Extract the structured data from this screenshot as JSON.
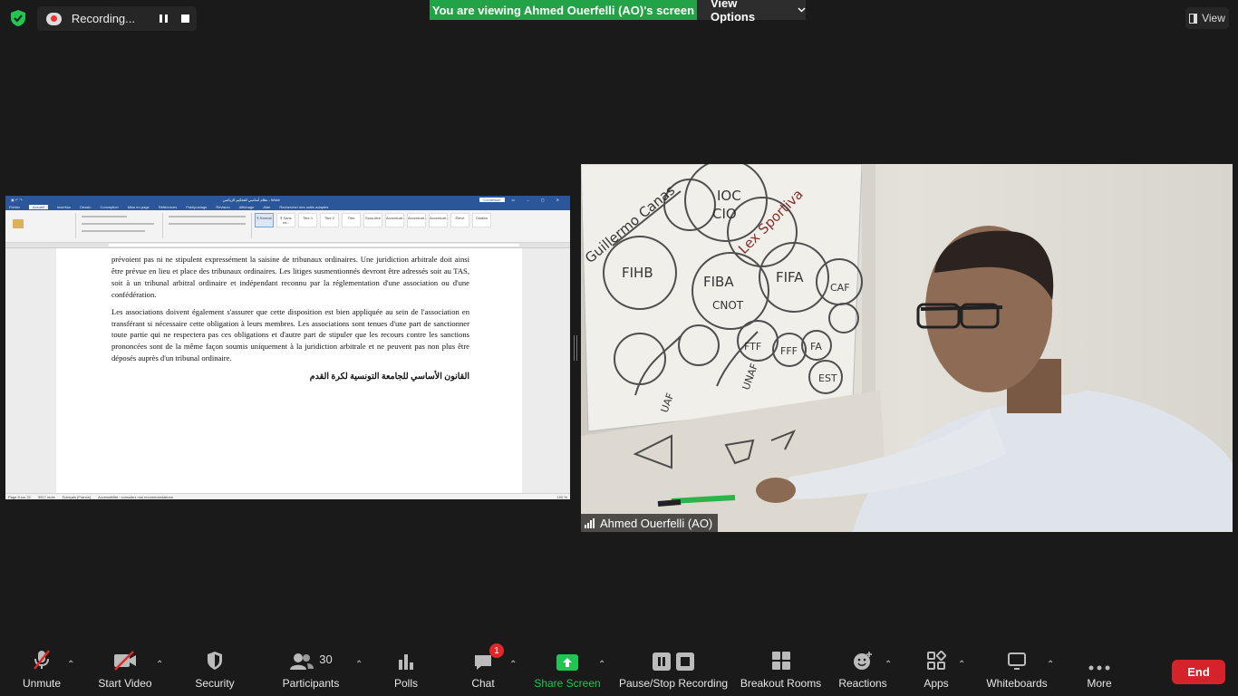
{
  "top": {
    "recording_label": "Recording...",
    "viewing_banner": "You are viewing Ahmed Ouerfelli (AO)'s screen",
    "view_options": "View Options",
    "view_label": "View"
  },
  "word": {
    "title": "نظام أساسي للتحكيم الرياضي - Word",
    "connect": "Connexion",
    "tabs": [
      "Fichier",
      "Accueil",
      "Insertion",
      "Dessin",
      "Conception",
      "Mise en page",
      "Références",
      "Publipostage",
      "Révision",
      "Affichage",
      "Aide",
      "Rechercher des outils adaptés"
    ],
    "styles": [
      "¶ Normal",
      "¶ Sans int...",
      "Titre 1",
      "Titre 2",
      "Titre",
      "Sous-titre",
      "Accentuat...",
      "Accentuat...",
      "Accentuat...",
      "Élevé",
      "Citation"
    ],
    "paragraph_1": "prévoient pas ni ne stipulent expressément la saisine de tribunaux ordinaires. Une juridiction arbitrale doit ainsi être prévue en lieu et place des tribunaux ordinaires. Les litiges susmentionnés devront être adressés soit au TAS, soit à un tribunal arbitral ordinaire et indépendant reconnu par la réglementation d'une association ou d'une confédération.",
    "paragraph_2": "Les associations doivent également s'assurer que cette disposition est bien appliquée au sein de l'association en transférant si nécessaire cette obligation à leurs membres. Les associations sont tenues d'une part de sanctionner toute partie qui ne respectera pas ces obligations et d'autre part de stipuler que les recours contre les sanctions prononcées sont de la même façon soumis uniquement à la juridiction arbitrale et ne peuvent pas non plus être déposés auprès d'un tribunal ordinaire.",
    "arabic_heading": "القانون الأساسي للجامعة التونسية لكرة القدم",
    "status_page": "Page 8 sur 22",
    "status_words": "3917 mots",
    "status_lang": "Français (France)",
    "status_access": "Accessibilité : consultez nos recommandations",
    "status_zoom": "100 %"
  },
  "video": {
    "participant_name": "Ahmed Ouerfelli (AO)",
    "whiteboard_words": [
      "IOC",
      "CIO",
      "Guillermo Canas",
      "Lex Sportiva",
      "FIFA",
      "FIBA",
      "CNOT",
      "FIHB",
      "FTF",
      "UAF",
      "UNAF",
      "CAF",
      "FA",
      "FFF",
      "EST"
    ]
  },
  "toolbar": {
    "unmute": "Unmute",
    "start_video": "Start Video",
    "security": "Security",
    "participants": "Participants",
    "participants_count": "30",
    "polls": "Polls",
    "chat": "Chat",
    "chat_badge": "1",
    "share_screen": "Share Screen",
    "pause_stop": "Pause/Stop Recording",
    "breakout": "Breakout Rooms",
    "reactions": "Reactions",
    "apps": "Apps",
    "whiteboards": "Whiteboards",
    "more": "More",
    "end": "End"
  },
  "colors": {
    "background": "#1a1a1a",
    "banner_green": "#23a347",
    "share_green": "#23c552",
    "end_red": "#d4232a",
    "word_blue": "#2b579a"
  }
}
